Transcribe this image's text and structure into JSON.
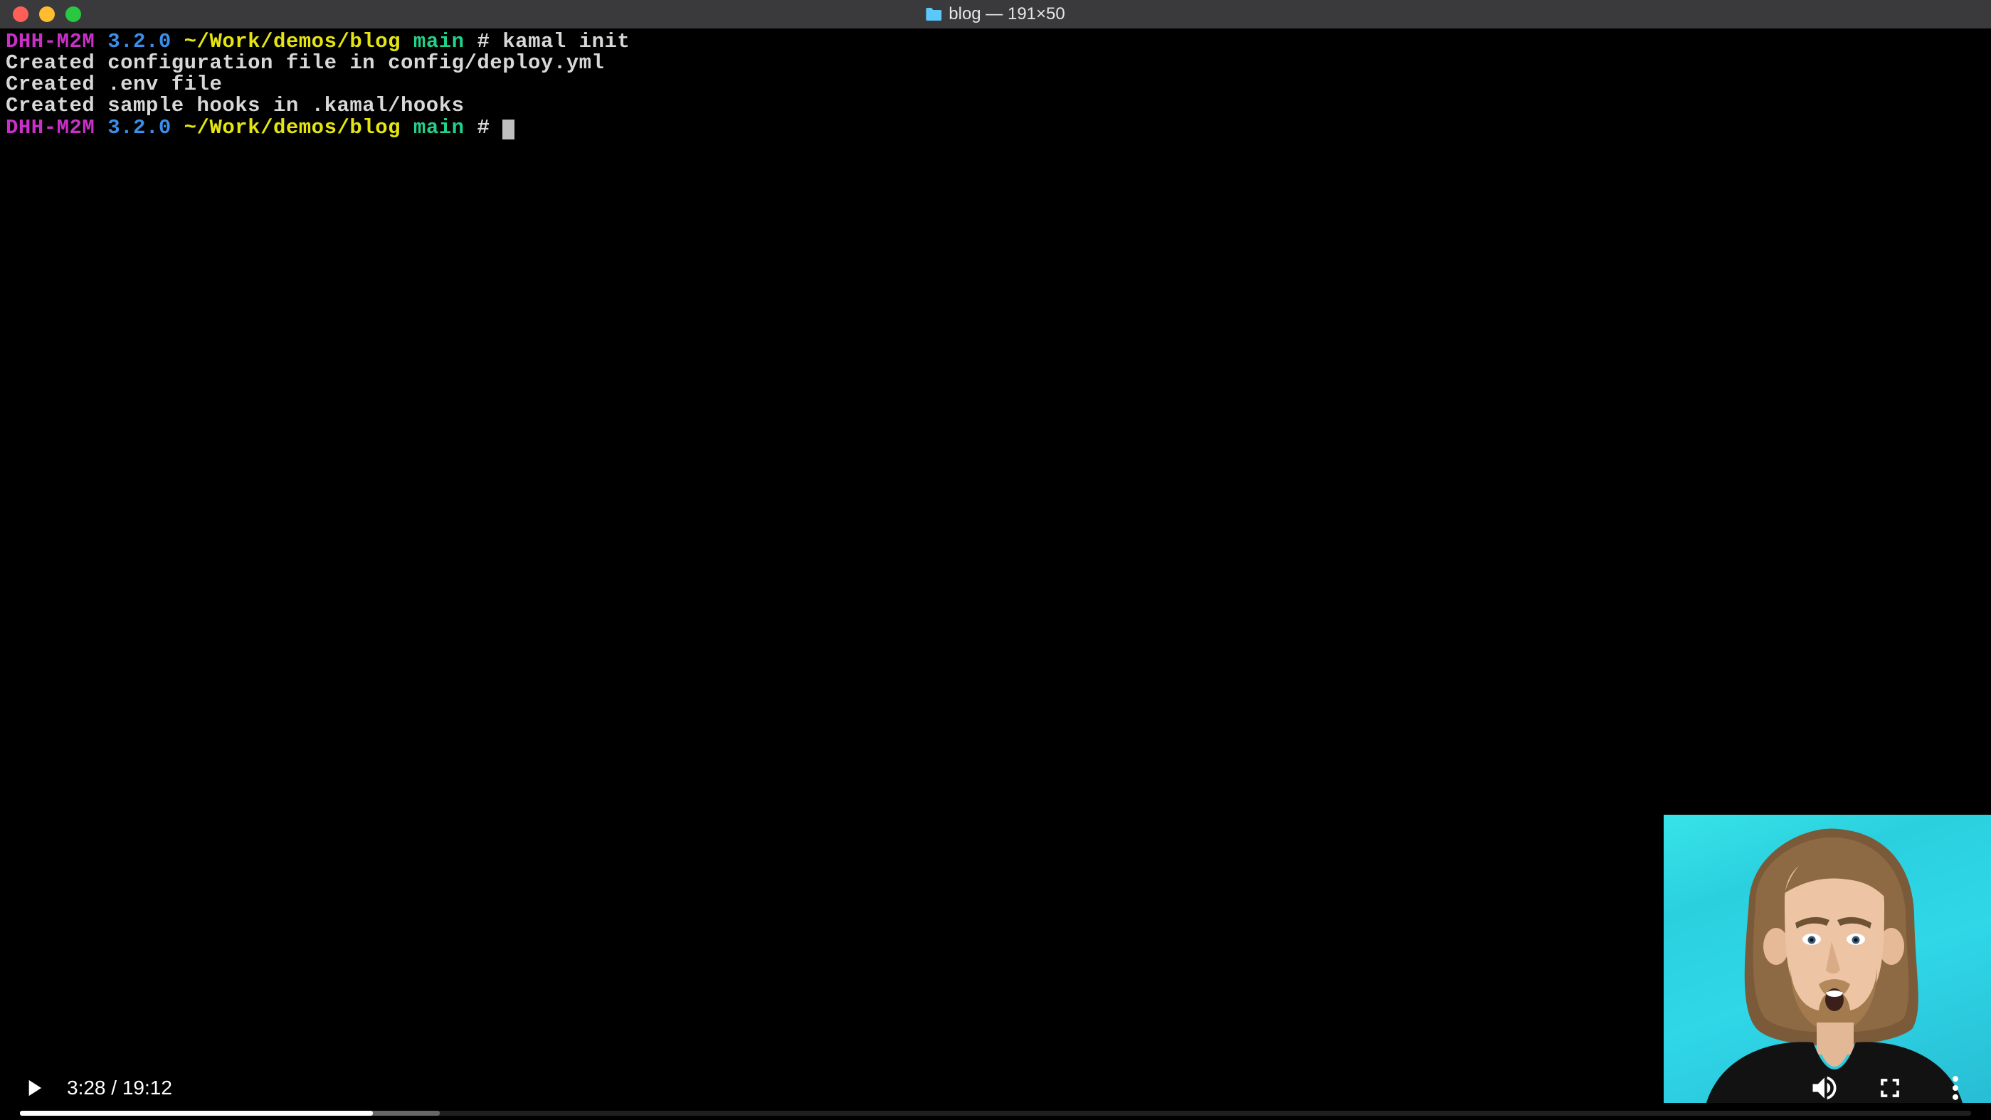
{
  "title_bar": {
    "title": "blog — 191×50"
  },
  "terminal": {
    "prompt": {
      "host": "DHH-M2M",
      "version": "3.2.0",
      "path": "~/Work/demos/blog",
      "branch": "main",
      "symbol": "#"
    },
    "command": "kamal init",
    "output_lines": [
      "Created configuration file in config/deploy.yml",
      "Created .env file",
      "Created sample hooks in .kamal/hooks"
    ]
  },
  "video": {
    "current_time": "3:28",
    "duration": "19:12",
    "separator": " / ",
    "played_pct": 18.1,
    "buffer_pct": 21.5
  }
}
